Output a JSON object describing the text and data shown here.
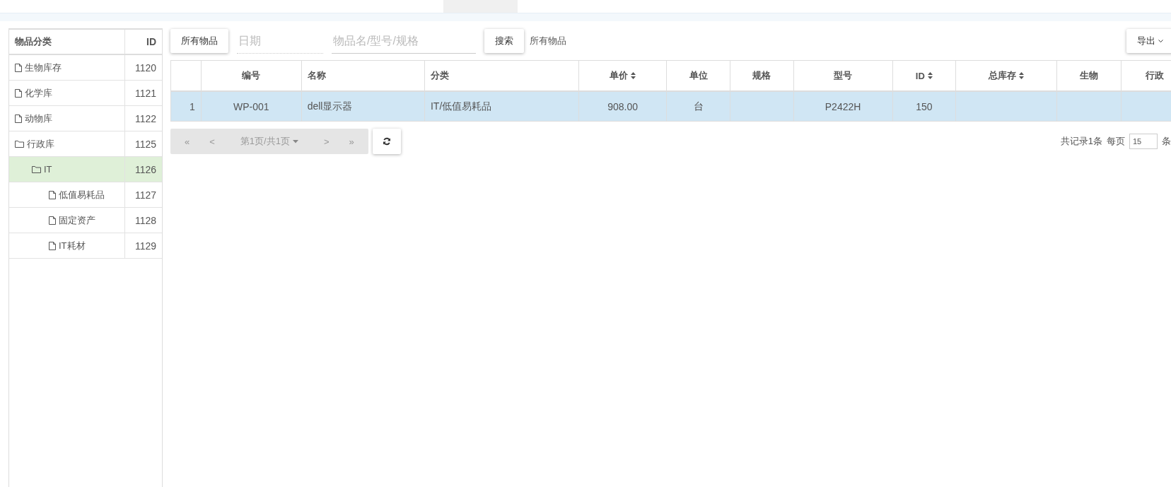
{
  "tree": {
    "columns": [
      "物品分类",
      "ID"
    ],
    "items": [
      {
        "kind": "file",
        "label": "生物库存",
        "id": "1120",
        "selected": false
      },
      {
        "kind": "file",
        "label": "化学库",
        "id": "1121",
        "selected": false
      },
      {
        "kind": "file",
        "label": "动物库",
        "id": "1122",
        "selected": false
      },
      {
        "kind": "folder",
        "label": "行政库",
        "id": "1125",
        "selected": false,
        "children": [
          {
            "kind": "folder",
            "label": "IT",
            "id": "1126",
            "selected": true,
            "children": [
              {
                "kind": "file",
                "label": "低值易耗品",
                "id": "1127",
                "selected": false
              },
              {
                "kind": "file",
                "label": "固定资产",
                "id": "1128",
                "selected": false
              },
              {
                "kind": "file",
                "label": "IT耗材",
                "id": "1129",
                "selected": false
              }
            ]
          }
        ]
      }
    ]
  },
  "toolbar": {
    "all_button": "所有物品",
    "date": {
      "placeholder": "日期"
    },
    "search": {
      "placeholder": "物品名/型号/规格"
    },
    "search_button": "搜索",
    "filter_label": "所有物品",
    "export_button": "导出"
  },
  "table": {
    "columns": [
      {
        "sortable": false
      },
      {
        "label": "编号",
        "sortable": false
      },
      {
        "label": "名称",
        "sortable": false
      },
      {
        "label": "分类",
        "sortable": false
      },
      {
        "label": "单价",
        "sortable": true
      },
      {
        "label": "单位",
        "sortable": false
      },
      {
        "label": "规格",
        "sortable": false
      },
      {
        "label": "型号",
        "sortable": false
      },
      {
        "label": "ID",
        "sortable": true
      },
      {
        "label": "总库存",
        "sortable": true
      },
      {
        "label": "生物",
        "sortable": false
      },
      {
        "label": "行政",
        "sortable": false
      }
    ],
    "rows": [
      {
        "selected": true,
        "cells": [
          "1",
          "WP-001",
          "dell显示器",
          "IT/低值易耗品",
          "908.00",
          "台",
          null,
          "P2422H",
          "150",
          null,
          null,
          null
        ]
      }
    ]
  },
  "pagination": {
    "first": "«",
    "prev": "<",
    "page": "第1页/共1页",
    "next": ">",
    "last": "»",
    "total": "共记录1条",
    "per_page_label": "每页",
    "per_page": "15",
    "unit": "条"
  }
}
